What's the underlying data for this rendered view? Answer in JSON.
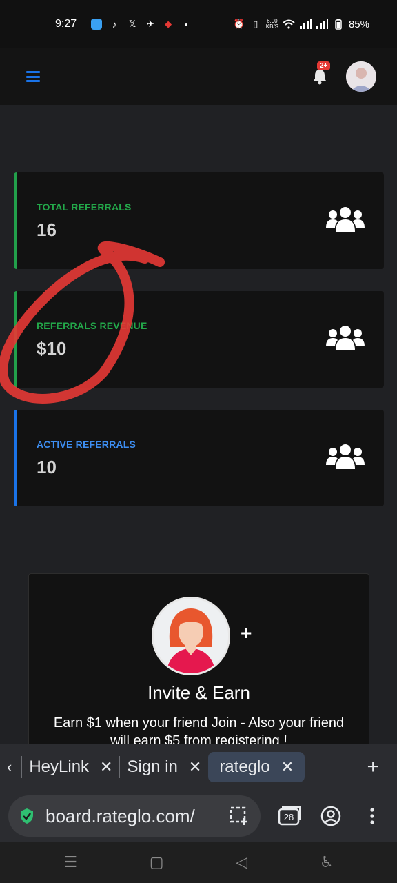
{
  "status_bar": {
    "time": "9:27",
    "network_speed_value": "6.00",
    "network_speed_unit": "KB/S",
    "battery": "85%"
  },
  "header": {
    "notification_badge": "2+"
  },
  "stats": [
    {
      "label": "TOTAL REFERRALS",
      "value": "16",
      "color": "#23a84a"
    },
    {
      "label": "REFERRALS REVENUE",
      "value": "$10",
      "color": "#23a84a"
    },
    {
      "label": "ACTIVE REFERRALS",
      "value": "10",
      "color": "#3d8ef2"
    }
  ],
  "invite": {
    "plus": "+",
    "title": "Invite & Earn",
    "text": "Earn $1 when your friend Join - Also your friend will earn $5 from registering !"
  },
  "browser": {
    "tabs": [
      {
        "title": "HeyLink"
      },
      {
        "title": "Sign in"
      },
      {
        "title": "rateglo",
        "active": true
      }
    ],
    "url": "board.rateglo.com/",
    "tab_count": "28"
  },
  "colors": {
    "accent_blue": "#1a73e8",
    "accent_green": "#23a84a",
    "annotation_red": "#e53935"
  }
}
